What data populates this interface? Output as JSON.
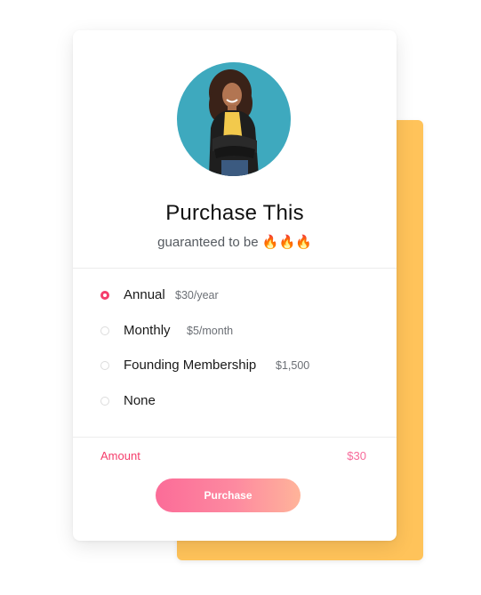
{
  "colors": {
    "accent": "#f53d6b",
    "backdrop": "#ffc35a",
    "avatar_bg": "#3ea9be"
  },
  "profile": {
    "avatar_icon": "woman-portrait-avatar"
  },
  "header": {
    "title": "Purchase This",
    "subtitle": "guaranteed to be 🔥🔥🔥"
  },
  "plans": [
    {
      "label": "Annual",
      "price": "$30/year",
      "selected": true
    },
    {
      "label": "Monthly",
      "price": "$5/month",
      "selected": false
    },
    {
      "label": "Founding Membership",
      "price": "$1,500",
      "selected": false
    },
    {
      "label": "None",
      "price": "",
      "selected": false
    }
  ],
  "summary": {
    "amount_label": "Amount",
    "amount_value": "$30"
  },
  "actions": {
    "purchase_label": "Purchase"
  }
}
